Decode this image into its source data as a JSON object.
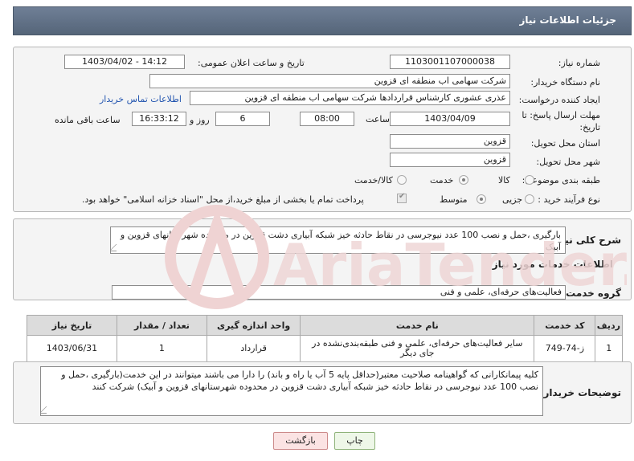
{
  "page_title": "جزئیات اطلاعات نیاز",
  "labels": {
    "need_number": "شماره نیاز:",
    "announce_datetime": "تاریخ و ساعت اعلان عمومی:",
    "buyer_org": "نام دستگاه خریدار:",
    "requester": "ایجاد کننده درخواست:",
    "contact_link": "اطلاعات تماس خریدار",
    "deadline": "مهلت ارسال پاسخ: تا تاریخ:",
    "time_word": "ساعت",
    "day_and": "روز و",
    "remaining": "ساعت باقی مانده",
    "delivery_province": "استان محل تحویل:",
    "delivery_city": "شهر محل تحویل:",
    "category": "طبقه بندی موضوعی:",
    "purchase_type": "نوع فرآیند خرید :",
    "general_desc": "شرح کلی نیاز:",
    "services_info": "اطلاعات خدمات مورد نیاز",
    "service_group": "گروه خدمت:",
    "buyer_notes": "توضیحات خریدار:"
  },
  "values": {
    "need_number": "1103001107000038",
    "announce_datetime": "1403/04/02 - 14:12",
    "buyer_org": "شرکت سهامی اب منطقه ای قزوین",
    "requester": "عذری عشوری کارشناس قراردادها شرکت سهامی اب منطقه ای قزوین",
    "deadline_date": "1403/04/09",
    "deadline_time": "08:00",
    "days_left": "6",
    "time_left": "16:33:12",
    "province": "قزوین",
    "city": "قزوین",
    "general_desc": "بارگیری ،حمل و نصب 100 عدد نیوجرسی در نقاط حادثه خیز شبکه آبیاری دشت قزوین در محدوده شهرستانهای قزوین و آبیک",
    "service_group": "فعالیت‌های حرفه‌ای، علمی و فنی",
    "buyer_notes": "کلیه پیمانکارانی که گواهینامه صلاحیت معتبر(حداقل پایه 5 آب یا راه و باند) را دارا می باشند میتوانند در این خدمت(بارگیری ،حمل و نصب 100 عدد نیوجرسی در نقاط حادثه خیز شبکه آبیاری دشت قزوین در محدوده شهرستانهای قزوین و آبیک) شرکت کنند"
  },
  "category_options": {
    "goods": "کالا",
    "service": "خدمت",
    "goods_service": "کالا/خدمت",
    "selected": "service"
  },
  "purchase_options": {
    "partial": "جزیی",
    "medium": "متوسط",
    "selected": "medium",
    "treasury_note": "پرداخت تمام یا بخشی از مبلغ خرید،از محل \"اسناد خزانه اسلامی\" خواهد بود."
  },
  "table": {
    "headers": [
      "ردیف",
      "کد خدمت",
      "نام خدمت",
      "واحد اندازه گیری",
      "تعداد / مقدار",
      "تاریخ نیاز"
    ],
    "rows": [
      [
        "1",
        "ز-74-749",
        "سایر فعالیت‌های حرفه‌ای، علمی و فنی طبقه‌بندی‌نشده در جای دیگر",
        "قرارداد",
        "1",
        "1403/06/31"
      ]
    ]
  },
  "buttons": {
    "print": "چاپ",
    "back": "بازگشت"
  },
  "watermark": "AriaTender.neT",
  "colors": {
    "title_bar": "#5f6f85",
    "link": "#2456b0",
    "watermark": "#e8c9c9"
  }
}
